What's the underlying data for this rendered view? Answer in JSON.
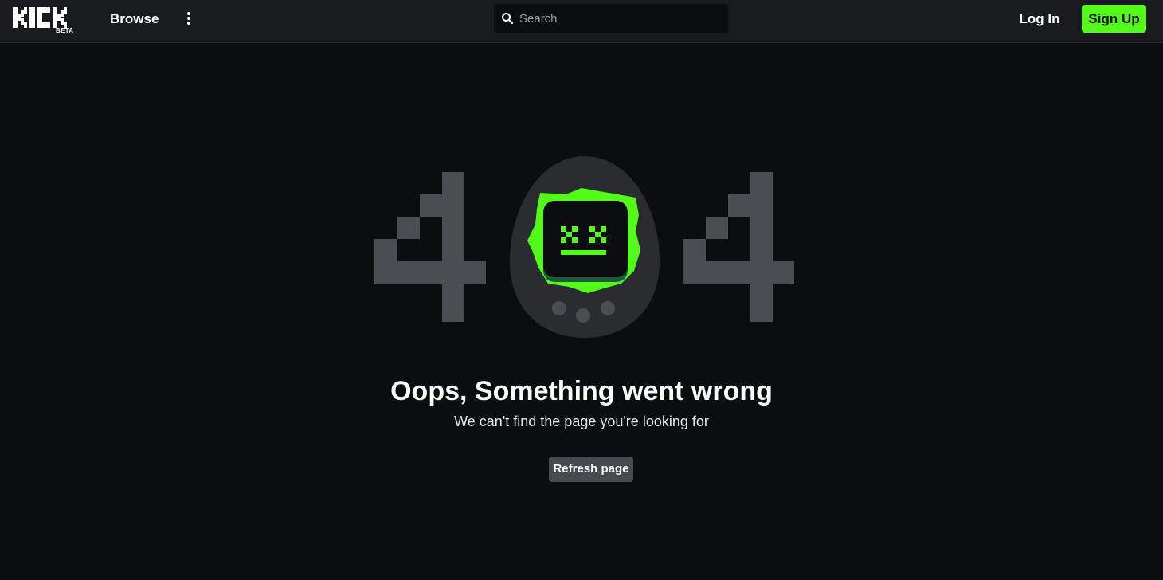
{
  "header": {
    "logo_beta": "BETA",
    "browse_label": "Browse",
    "search": {
      "placeholder": "Search",
      "value": ""
    },
    "login_label": "Log In",
    "signup_label": "Sign Up"
  },
  "error": {
    "title": "Oops, Something went wrong",
    "subtitle": "We can't find the page you're looking for",
    "refresh_label": "Refresh page"
  },
  "colors": {
    "brand_green": "#53fc18",
    "topbar": "#191b1f",
    "background": "#0b0e0f",
    "digit_gray": "#4a4d52"
  },
  "icons": [
    "kick-logo",
    "more-vertical-icon",
    "search-icon",
    "tamagotchi-error-icon"
  ]
}
